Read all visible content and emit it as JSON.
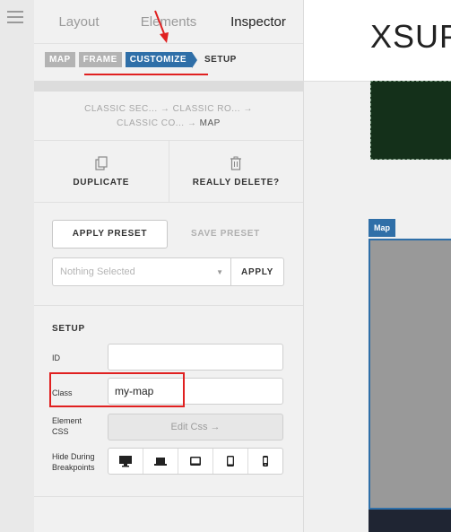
{
  "tabs": [
    {
      "label": "Layout",
      "active": false
    },
    {
      "label": "Elements",
      "active": false
    },
    {
      "label": "Inspector",
      "active": true
    }
  ],
  "breadcrumb": {
    "chips": [
      "MAP",
      "FRAME",
      "CUSTOMIZE"
    ],
    "current_step": "SETUP"
  },
  "element_path": {
    "line1": "CLASSIC SEC... → CLASSIC RO... →",
    "line2_prefix": "CLASSIC CO... → ",
    "current": "MAP"
  },
  "actions": {
    "duplicate": "DUPLICATE",
    "delete": "REALLY DELETE?"
  },
  "presets": {
    "apply_preset": "APPLY PRESET",
    "save_preset": "SAVE PRESET",
    "select_value": "Nothing Selected",
    "apply": "APPLY"
  },
  "setup": {
    "title": "SETUP",
    "id_label": "ID",
    "id_value": "",
    "class_label": "Class",
    "class_value": "my-map",
    "element_css_label_1": "Element",
    "element_css_label_2": "CSS",
    "edit_css": "Edit Css →",
    "hide_label_1": "Hide During",
    "hide_label_2": "Breakpoints",
    "breakpoints": [
      "desktop-icon",
      "laptop-icon",
      "tablet-landscape-icon",
      "tablet-portrait-icon",
      "phone-icon"
    ]
  },
  "canvas": {
    "title": "XSUP",
    "map_tag": "Map"
  },
  "colors": {
    "accent": "#2f6fa8",
    "annotation_red": "#e02020",
    "dark_block": "#14301a",
    "map_placeholder": "#999999"
  }
}
